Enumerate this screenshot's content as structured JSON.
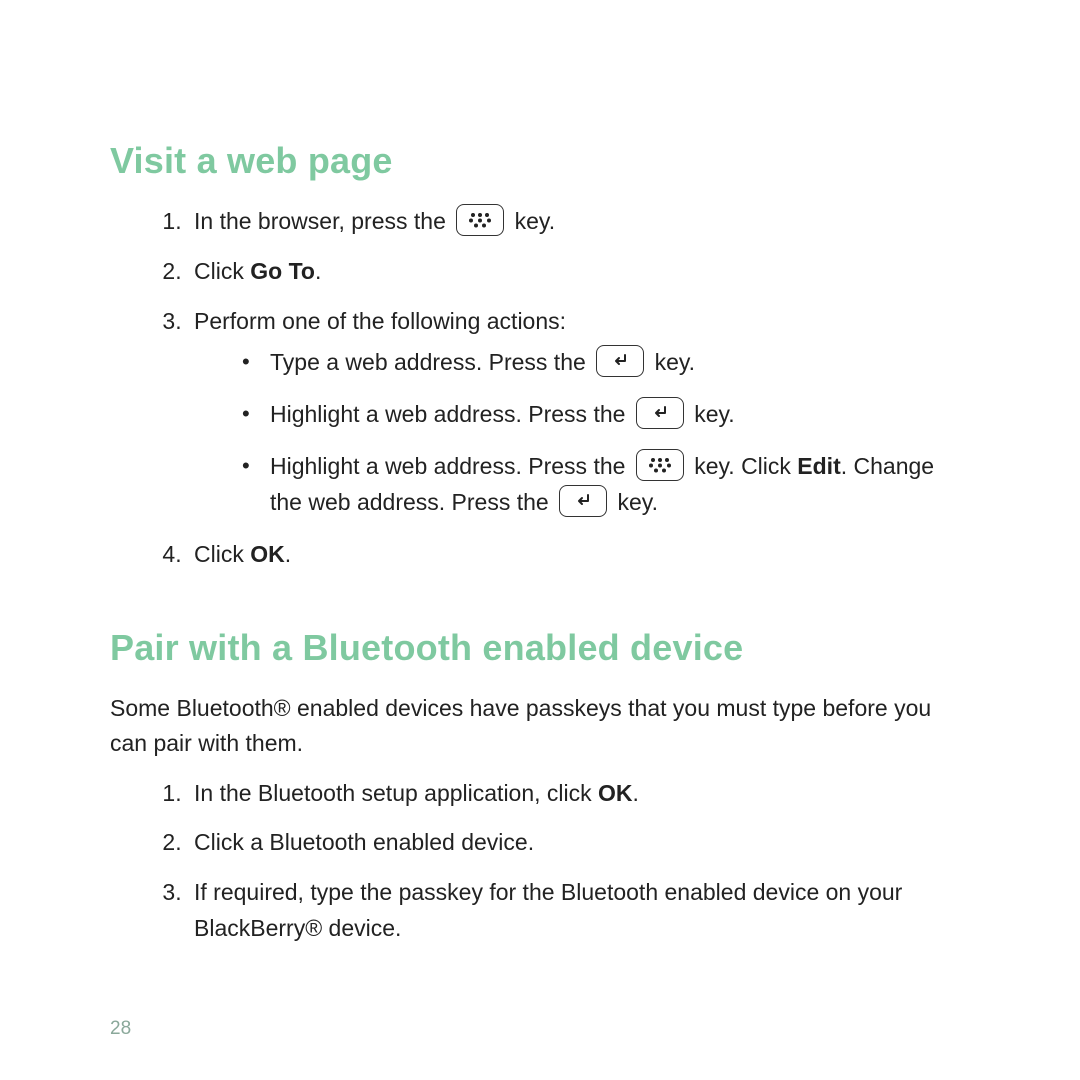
{
  "sections": {
    "visit": {
      "title": "Visit a web page",
      "step1_a": "In the browser, press the",
      "step1_b": "key.",
      "step2_a": "Click ",
      "step2_bold": "Go To",
      "step2_b": ".",
      "step3": "Perform one of the following actions:",
      "b1_a": "Type a web address. Press the",
      "b1_b": "key.",
      "b2_a": "Highlight a web address. Press the",
      "b2_b": "key.",
      "b3_a": "Highlight a web address. Press the",
      "b3_b": "key. Click ",
      "b3_bold": "Edit",
      "b3_c": ". Change the web address. Press the",
      "b3_d": "key.",
      "step4_a": "Click ",
      "step4_bold": "OK",
      "step4_b": "."
    },
    "pair": {
      "title": "Pair with a Bluetooth enabled device",
      "intro": "Some Bluetooth® enabled devices have passkeys that you must type before you can pair with them.",
      "step1_a": "In the Bluetooth setup application, click ",
      "step1_bold": "OK",
      "step1_b": ".",
      "step2": "Click a Bluetooth enabled device.",
      "step3": "If required, type the passkey for the Bluetooth enabled device on your BlackBerry® device."
    }
  },
  "page_number": "28"
}
